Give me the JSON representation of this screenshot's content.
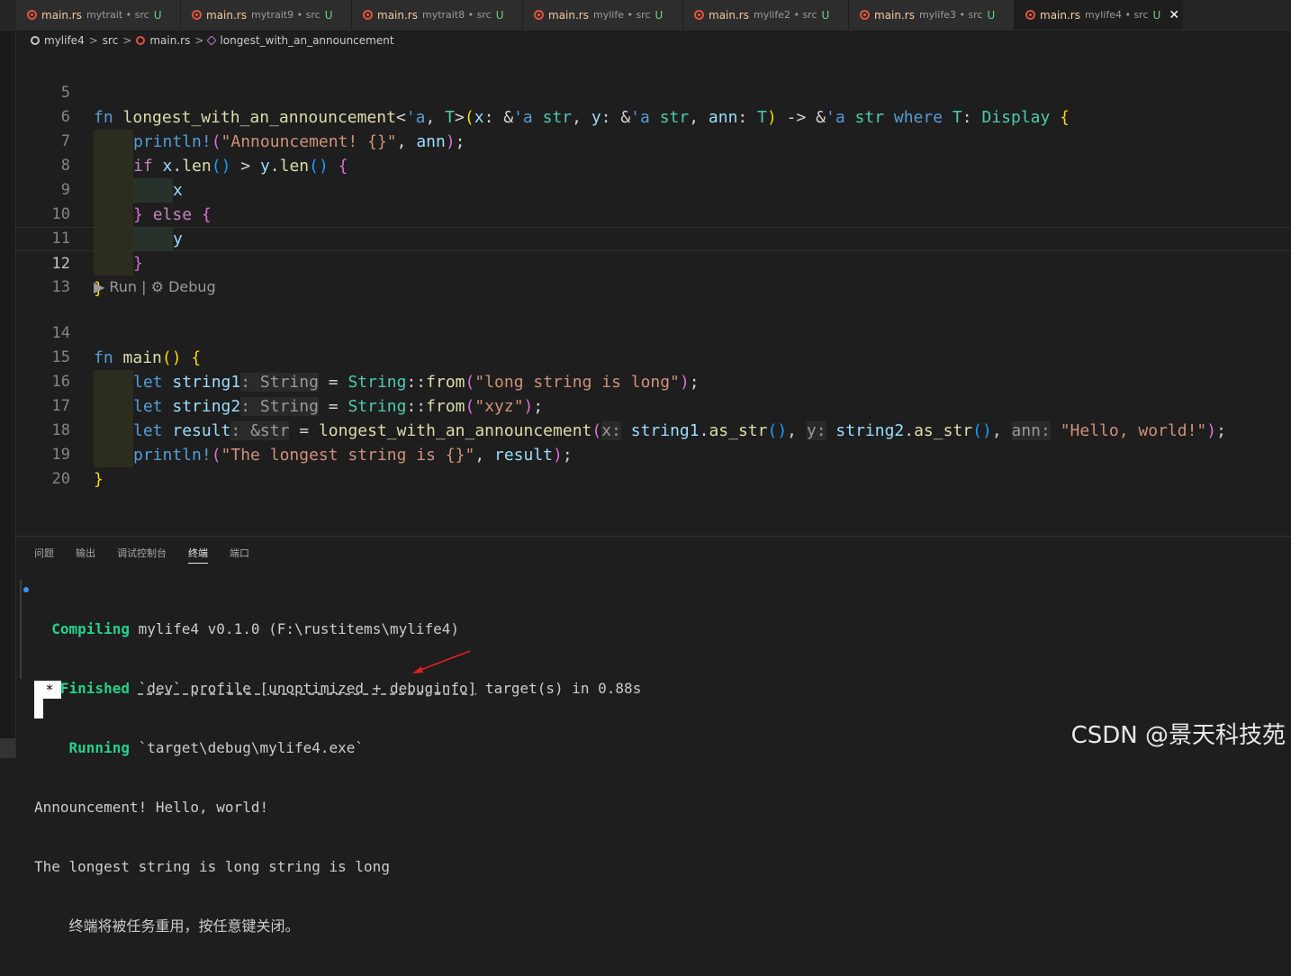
{
  "tabs": [
    {
      "file": "main.rs",
      "desc": "mytrait • src",
      "status": "U"
    },
    {
      "file": "main.rs",
      "desc": "mytrait9 • src",
      "status": "U"
    },
    {
      "file": "main.rs",
      "desc": "mytrait8 • src",
      "status": "U"
    },
    {
      "file": "main.rs",
      "desc": "mylife • src",
      "status": "U"
    },
    {
      "file": "main.rs",
      "desc": "mylife2 • src",
      "status": "U"
    },
    {
      "file": "main.rs",
      "desc": "mylife3 • src",
      "status": "U"
    },
    {
      "file": "main.rs",
      "desc": "mylife4 • src",
      "status": "U",
      "close": "✕"
    }
  ],
  "breadcrumb": {
    "project": "mylife4",
    "folder": "src",
    "file": "main.rs",
    "symbol": "longest_with_an_announcement",
    "sep": ">"
  },
  "editor": {
    "lines": [
      {
        "n": "5"
      },
      {
        "n": "6"
      },
      {
        "n": "7"
      },
      {
        "n": "8"
      },
      {
        "n": "9"
      },
      {
        "n": "10"
      },
      {
        "n": "11"
      },
      {
        "n": "12"
      },
      {
        "n": "13"
      },
      {
        "n": "14"
      },
      {
        "n": "15"
      },
      {
        "n": "16"
      },
      {
        "n": "17"
      },
      {
        "n": "18"
      },
      {
        "n": "19"
      },
      {
        "n": "20"
      }
    ],
    "codelens": "▶ Run | ⚙ Debug",
    "tokens": {
      "fn": "fn",
      "fn_name": "longest_with_an_announcement",
      "lt_a": "'a",
      "T": "T",
      "x": "x",
      "y": "y",
      "ann": "ann",
      "str": "str",
      "where": "where",
      "Display": "Display",
      "println": "println!",
      "announce_fmt": "\"Announcement! {}\"",
      "if": "if",
      "len": "len",
      "else": "else",
      "main": "main",
      "let": "let",
      "string1": "string1",
      "string2": "string2",
      "String": "String",
      "from": "from",
      "s1": "\"long string is long\"",
      "s2": "\"xyz\"",
      "result": "result",
      "hint_string": ": String",
      "hint_str": ": &str",
      "hint_x": "x:",
      "hint_y": "y:",
      "hint_ann": "ann:",
      "as_str": "as_str",
      "hello": "\"Hello, world!\"",
      "result_fmt": "\"The longest string is {}\""
    }
  },
  "panel": {
    "tabs": [
      "问题",
      "输出",
      "调试控制台",
      "终端",
      "端口"
    ],
    "active_tab": "终端",
    "terminal": {
      "compiling_label": "Compiling",
      "compiling_text": " mylife4 v0.1.0 (F:\\rustitems\\mylife4)",
      "finished_label": "Finished",
      "finished_text_1": "`dev` profile [unoptimized + debuginfo]",
      "finished_text_2": " target(s) in 0.88s",
      "running_label": "Running",
      "running_text": " `target\\debug\\mylife4.exe`",
      "out1": "Announcement! Hello, world!",
      "out2": "The longest string is long string is long",
      "reuse": "终端将被任务重用，按任意键关闭。",
      "cursor_char": "*"
    }
  },
  "watermark": "CSDN @景天科技苑"
}
